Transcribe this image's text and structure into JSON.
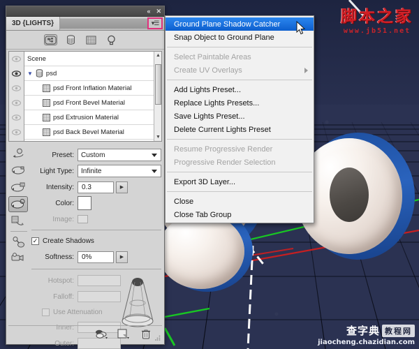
{
  "app": {
    "panel_tab": "3D {LIGHTS}",
    "titlebar": {
      "collapse": "«",
      "close": "✕"
    },
    "menu_button_icon": "panel-menu-icon"
  },
  "filters": [
    {
      "name": "scene-filter",
      "icon": "scene-icon",
      "selected": true
    },
    {
      "name": "mesh-filter",
      "icon": "mesh-icon",
      "selected": false
    },
    {
      "name": "material-filter",
      "icon": "material-grid-icon",
      "selected": false
    },
    {
      "name": "light-filter",
      "icon": "lightbulb-icon",
      "selected": false
    }
  ],
  "scene_tree": {
    "rows": [
      {
        "label": "Scene",
        "indent": false,
        "icon": "",
        "eye": "eye-dim",
        "expander": ""
      },
      {
        "label": "psd",
        "indent": false,
        "icon": "mesh-icon",
        "eye": "eye-on",
        "expander": "▼"
      },
      {
        "label": "psd Front Inflation Material",
        "indent": true,
        "icon": "material-icon",
        "eye": "eye-dim",
        "expander": ""
      },
      {
        "label": "psd Front Bevel Material",
        "indent": true,
        "icon": "material-icon",
        "eye": "eye-dim",
        "expander": ""
      },
      {
        "label": "psd Extrusion Material",
        "indent": true,
        "icon": "material-icon",
        "eye": "eye-dim",
        "expander": ""
      },
      {
        "label": "psd Back Bevel Material",
        "indent": true,
        "icon": "material-icon",
        "eye": "eye-dim",
        "expander": ""
      }
    ]
  },
  "tools": [
    {
      "name": "rotate-light-tool",
      "selected": false
    },
    {
      "name": "roll-light-tool",
      "selected": false
    },
    {
      "name": "pan-light-tool",
      "selected": false
    },
    {
      "name": "slide-light-tool",
      "selected": true
    },
    {
      "name": "scale-light-tool",
      "selected": false
    },
    {
      "name": "point-light-tool",
      "selected": false
    },
    {
      "name": "camera-light-tool",
      "selected": false
    }
  ],
  "properties": {
    "preset_label": "Preset:",
    "preset_value": "Custom",
    "light_type_label": "Light Type:",
    "light_type_value": "Infinite",
    "intensity_label": "Intensity:",
    "intensity_value": "0.3",
    "color_label": "Color:",
    "color_value": "#ffffff",
    "image_label": "Image:",
    "create_shadows_label": "Create Shadows",
    "create_shadows_checked": "✓",
    "softness_label": "Softness:",
    "softness_value": "0%",
    "hotspot_label": "Hotspot:",
    "falloff_label": "Falloff:",
    "use_attenuation_label": "Use Attenuation",
    "inner_label": "Inner:",
    "outer_label": "Outer:"
  },
  "panel_bottom": [
    {
      "name": "new-light-button",
      "icon": "lights-stack-icon"
    },
    {
      "name": "add-object-button",
      "icon": "new-layer-icon"
    },
    {
      "name": "delete-button",
      "icon": "trash-icon"
    }
  ],
  "context_menu": {
    "items": [
      {
        "label": "Ground Plane Shadow Catcher",
        "state": "highlighted",
        "submenu": false
      },
      {
        "label": "Snap Object to Ground Plane",
        "state": "normal",
        "submenu": false
      },
      {
        "label": "",
        "state": "separator",
        "submenu": false
      },
      {
        "label": "Select Paintable Areas",
        "state": "disabled",
        "submenu": false
      },
      {
        "label": "Create UV Overlays",
        "state": "disabled",
        "submenu": true
      },
      {
        "label": "",
        "state": "separator",
        "submenu": false
      },
      {
        "label": "Add Lights Preset...",
        "state": "normal",
        "submenu": false
      },
      {
        "label": "Replace Lights Presets...",
        "state": "normal",
        "submenu": false
      },
      {
        "label": "Save Lights Preset...",
        "state": "normal",
        "submenu": false
      },
      {
        "label": "Delete Current Lights Preset",
        "state": "normal",
        "submenu": false
      },
      {
        "label": "",
        "state": "separator",
        "submenu": false
      },
      {
        "label": "Resume Progressive Render",
        "state": "disabled",
        "submenu": false
      },
      {
        "label": "Progressive Render Selection",
        "state": "disabled",
        "submenu": false
      },
      {
        "label": "",
        "state": "separator",
        "submenu": false
      },
      {
        "label": "Export 3D Layer...",
        "state": "normal",
        "submenu": false
      },
      {
        "label": "",
        "state": "separator",
        "submenu": false
      },
      {
        "label": "Close",
        "state": "normal",
        "submenu": false
      },
      {
        "label": "Close Tab Group",
        "state": "normal",
        "submenu": false
      }
    ]
  },
  "watermarks": {
    "top_right_cn": "脚本之家",
    "top_right_url": "www.jb51.net",
    "bottom_right_cn": "查字典",
    "bottom_right_box": "教程网",
    "bottom_right_url": "jiaocheng.chazidian.com"
  },
  "colors": {
    "menu_highlight": "#0d5fcd",
    "menu_button_outline": "#e0327d",
    "viewport_bg": "#2b3252",
    "letter_side": "#2a63bd",
    "axis_green": "#18d021",
    "axis_red": "#cf1f1f"
  }
}
